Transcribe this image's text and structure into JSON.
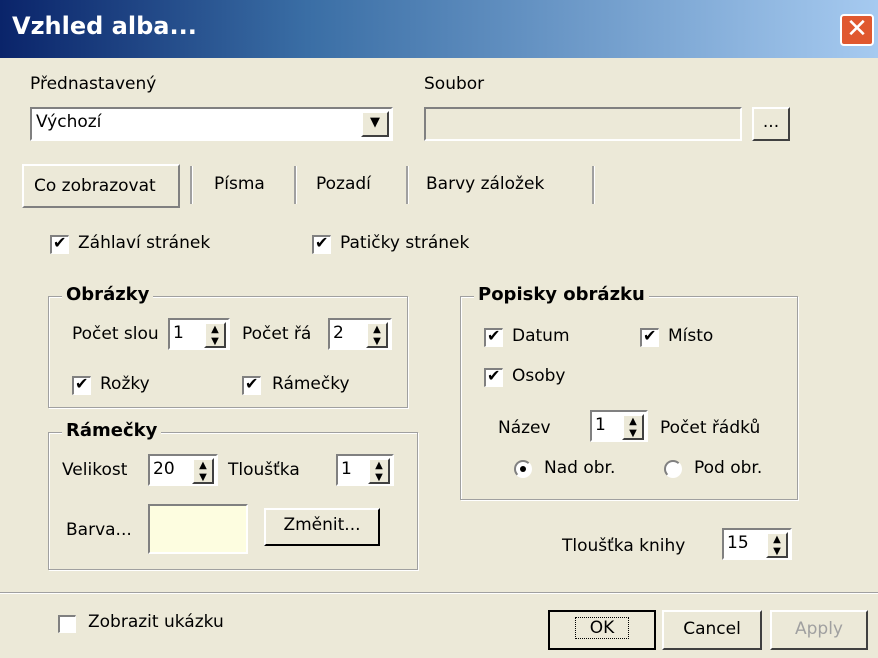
{
  "window": {
    "title": "Vzhled alba..."
  },
  "preset": {
    "label": "Přednastavený",
    "value": "Výchozí"
  },
  "file": {
    "label": "Soubor",
    "value": "",
    "browse_label": "..."
  },
  "tabs": [
    {
      "label": "Co zobrazovat",
      "active": true
    },
    {
      "label": "Písma",
      "active": false
    },
    {
      "label": "Pozadí",
      "active": false
    },
    {
      "label": "Barvy záložek",
      "active": false
    }
  ],
  "options": {
    "header": {
      "label": "Záhlaví stránek",
      "checked": true
    },
    "footer": {
      "label": "Patičky stránek",
      "checked": true
    }
  },
  "images_group": {
    "title": "Obrázky",
    "cols_label": "Počet slou",
    "cols_value": "1",
    "rows_label": "Počet řá",
    "rows_value": "2",
    "corners_label": "Rožky",
    "frames_label": "Rámečky"
  },
  "frames_group": {
    "title": "Rámečky",
    "size_label": "Velikost",
    "size_value": "20",
    "thickness_label": "Tloušťka",
    "thickness_value": "1",
    "color_label": "Barva...",
    "color_swatch": "#fdfde0",
    "change_label": "Změnit..."
  },
  "captions_group": {
    "title": "Popisky obrázku",
    "date_label": "Datum",
    "place_label": "Místo",
    "people_label": "Osoby",
    "name_label": "Název",
    "name_value": "1",
    "lines_label": "Počet řádků",
    "above_label": "Nad obr.",
    "below_label": "Pod obr."
  },
  "book_thickness": {
    "label": "Tloušťka knihy",
    "value": "15"
  },
  "footer_bar": {
    "preview_label": "Zobrazit ukázku",
    "ok_label": "OK",
    "cancel_label": "Cancel",
    "apply_label": "Apply"
  },
  "icons": {
    "check": "✔",
    "dropdown": "▼",
    "up": "▲",
    "down": "▼",
    "close": "✕"
  }
}
